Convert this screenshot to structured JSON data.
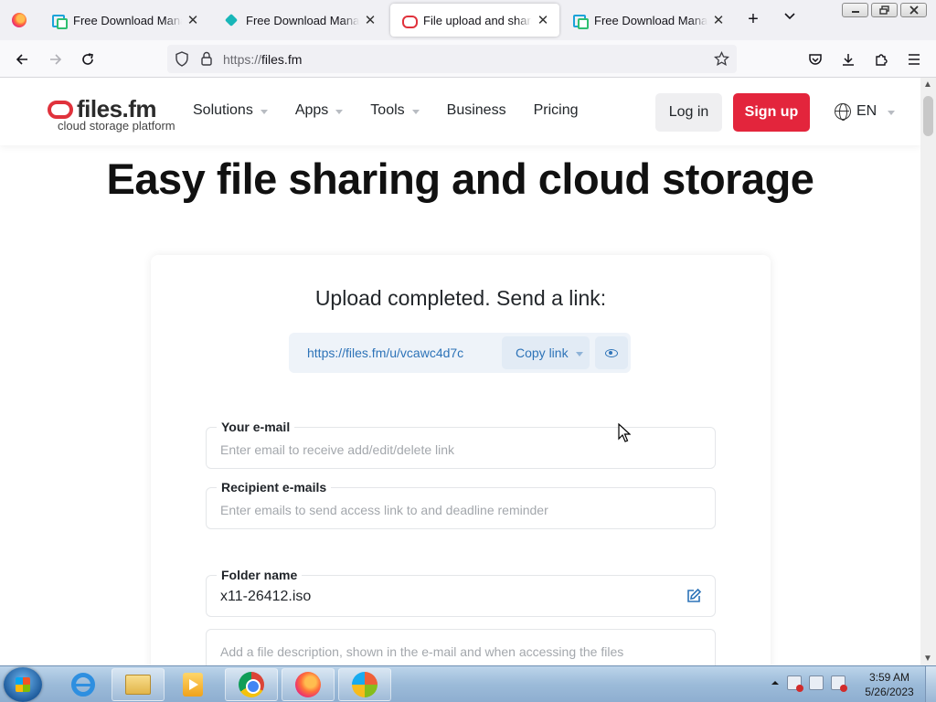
{
  "browser": {
    "tabs": [
      {
        "title": "Free Download Manager",
        "favicon": "fdm-icon",
        "active": false
      },
      {
        "title": "Free Download Manager",
        "favicon": "puzzle-icon",
        "active": false
      },
      {
        "title": "File upload and sharing. Large file transfer",
        "favicon": "files-fm-icon",
        "active": true
      },
      {
        "title": "Free Download Manager",
        "favicon": "fdm-icon",
        "active": false
      }
    ],
    "new_tab_symbol": "+",
    "url_prefix": "https://",
    "url_host": "files.fm",
    "window_buttons": [
      "minimize",
      "restore",
      "close"
    ]
  },
  "site": {
    "brand_name": "files.fm",
    "brand_tagline": "cloud storage platform",
    "menu": [
      {
        "label": "Solutions",
        "has_dropdown": true
      },
      {
        "label": "Apps",
        "has_dropdown": true
      },
      {
        "label": "Tools",
        "has_dropdown": true
      },
      {
        "label": "Business",
        "has_dropdown": false
      },
      {
        "label": "Pricing",
        "has_dropdown": false
      }
    ],
    "login_label": "Log in",
    "signup_label": "Sign up",
    "language": "EN",
    "accent_color": "#e3253c",
    "link_color": "#2d73b8"
  },
  "hero": {
    "title": "Easy file sharing and cloud storage"
  },
  "upload": {
    "status_title": "Upload completed. Send a link:",
    "share_link": "https://files.fm/u/vcawc4d7c",
    "copy_label": "Copy link",
    "fields": {
      "your_email": {
        "label": "Your e-mail",
        "placeholder": "Enter email to receive add/edit/delete link",
        "value": ""
      },
      "recipients": {
        "label": "Recipient e-mails",
        "placeholder": "Enter emails to send access link to and deadline reminder",
        "value": ""
      },
      "folder_name": {
        "label": "Folder name",
        "value": "x11-26412.iso"
      },
      "description": {
        "placeholder": "Add a file description, shown in the e-mail and when accessing the files",
        "value": ""
      }
    }
  },
  "taskbar": {
    "clock_time": "3:59 AM",
    "clock_date": "5/26/2023",
    "pinned": [
      "internet-explorer-icon",
      "file-explorer-icon",
      "media-player-icon",
      "chrome-icon",
      "firefox-icon",
      "windows-icon"
    ]
  }
}
